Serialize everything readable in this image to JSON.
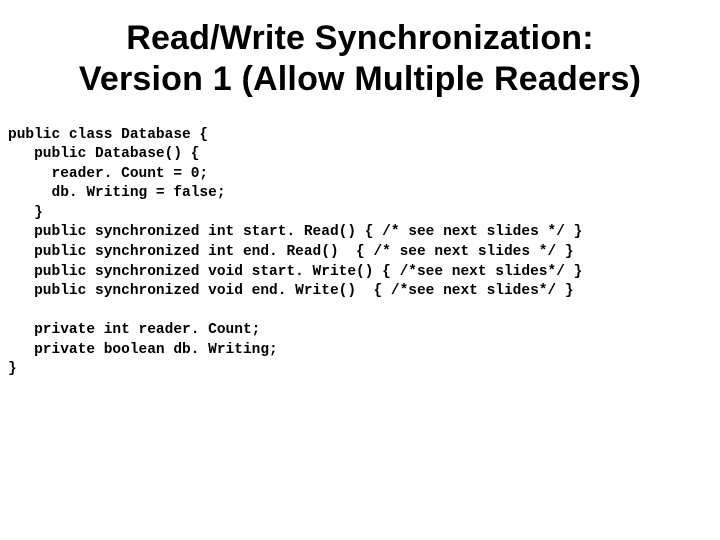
{
  "title_line1": "Read/Write Synchronization:",
  "title_line2": "Version 1 (Allow Multiple Readers)",
  "code": {
    "l01": "public class Database {",
    "l02": "   public Database() {",
    "l03": "     reader. Count = 0;",
    "l04": "     db. Writing = false;",
    "l05": "   }",
    "l06": "   public synchronized int start. Read() { /* see next slides */ }",
    "l07": "   public synchronized int end. Read()  { /* see next slides */ }",
    "l08": "   public synchronized void start. Write() { /*see next slides*/ }",
    "l09": "   public synchronized void end. Write()  { /*see next slides*/ }",
    "l10": "",
    "l11": "   private int reader. Count;",
    "l12": "   private boolean db. Writing;",
    "l13": "}"
  }
}
